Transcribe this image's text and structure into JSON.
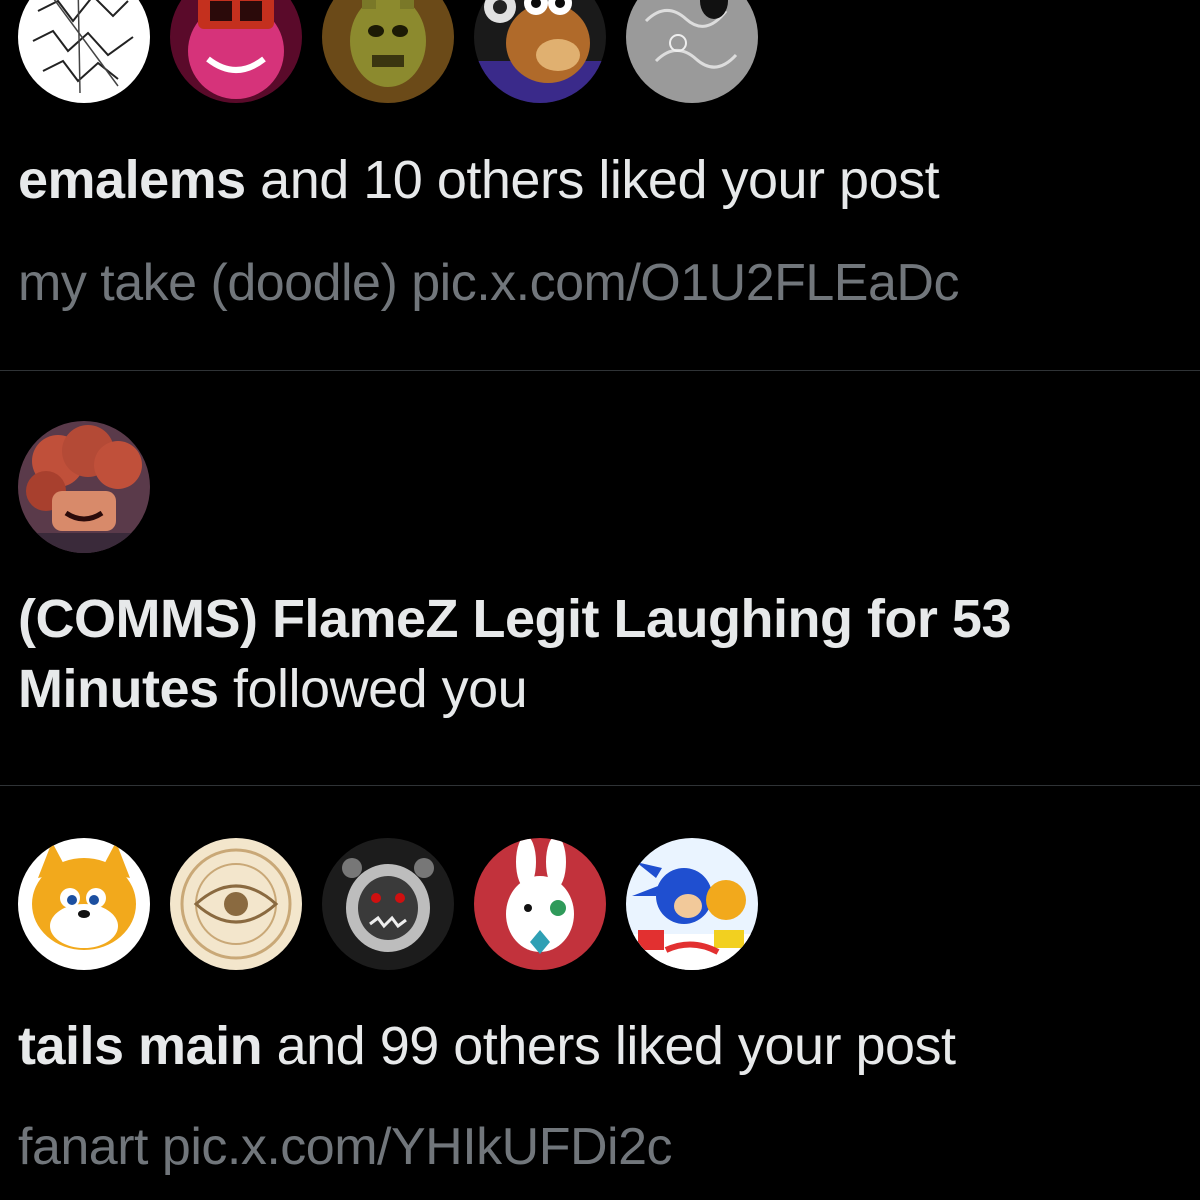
{
  "theme": {
    "background": "#000000",
    "primary_text": "#e7e9ea",
    "secondary_text": "#71767b",
    "divider": "#2f3336"
  },
  "notifications": [
    {
      "type": "like",
      "avatars": [
        "white-doodle-avatar",
        "pink-monster-avatar",
        "springtrap-avatar",
        "banjo-avatar",
        "gray-sketch-avatar"
      ],
      "actor": "emalems",
      "action": " and 10 others liked your post",
      "snippet_text": "my take (doodle) ",
      "snippet_link": "pic.x.com/O1U2FLEaDc"
    },
    {
      "type": "follow",
      "avatars": [
        "orange-curly-hair-avatar"
      ],
      "actor": "(COMMS) FlameZ Legit Laughing for 53 Minutes",
      "action": " followed you"
    },
    {
      "type": "like",
      "avatars": [
        "tails-avatar",
        "eye-emblem-avatar",
        "dark-creature-avatar",
        "white-rabbit-avatar",
        "sonic-tails-avatar"
      ],
      "actor": "tails main",
      "action": " and 99 others liked your post",
      "snippet_text": "fanart ",
      "snippet_link": "pic.x.com/YHIkUFDi2c"
    }
  ]
}
